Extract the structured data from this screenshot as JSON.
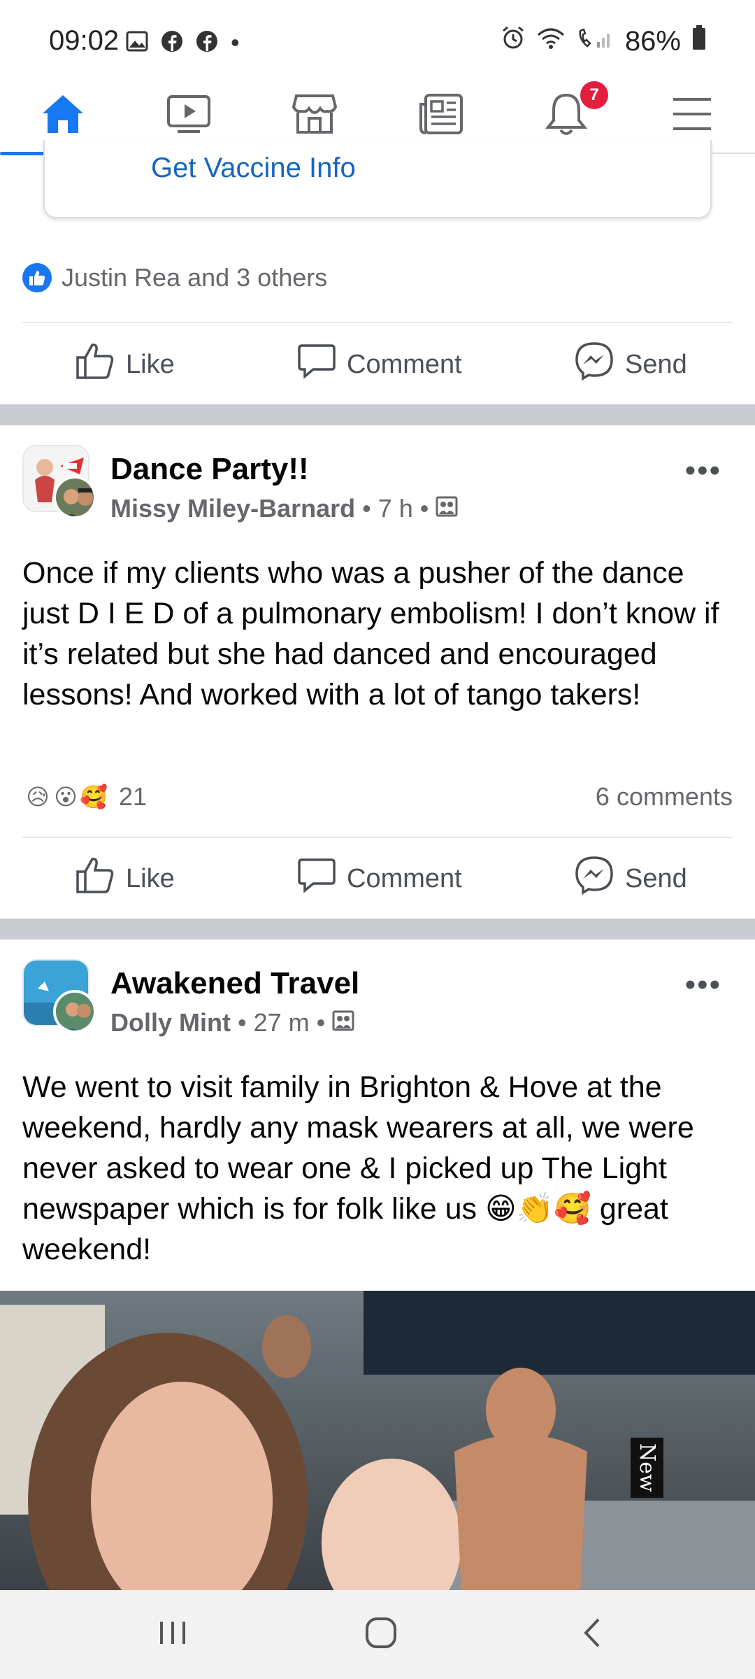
{
  "status_bar": {
    "time": "09:02",
    "battery": "86%",
    "dot": "•"
  },
  "nav": {
    "tabs": [
      "home-icon",
      "video-icon",
      "marketplace-icon",
      "news-icon",
      "notifications-icon",
      "menu-icon"
    ],
    "notification_count": "7",
    "accent": "#1877f2"
  },
  "vaccine_card": {
    "link_text": "Get Vaccine Info"
  },
  "prev_post": {
    "reactions_text": "Justin Rea and 3 others"
  },
  "actions": {
    "like": "Like",
    "comment": "Comment",
    "send": "Send"
  },
  "posts": [
    {
      "group": "Dance Party!!",
      "author": "Missy Miley-Barnard",
      "sep1": "•",
      "time": "7 h",
      "sep2": "•",
      "text": "Once if my clients who was a pusher of the dance just D I E D of a pulmonary embolism! I don’t know if it’s related but she had danced and encouraged lessons! And worked with a lot of tango takers!",
      "reaction_emojis": [
        "😥",
        "😮",
        "🥰"
      ],
      "reaction_count": "21",
      "comments": "6 comments"
    },
    {
      "group": "Awakened Travel",
      "author": "Dolly Mint",
      "sep1": "•",
      "time": "27 m",
      "sep2": "•",
      "text": "We went to visit family in Brighton & Hove at the weekend, hardly any mask wearers at all, we were never asked to wear one & I picked up The Light newspaper which is for folk like us 😁👏🥰 great weekend!",
      "photo_sign": "New"
    }
  ]
}
